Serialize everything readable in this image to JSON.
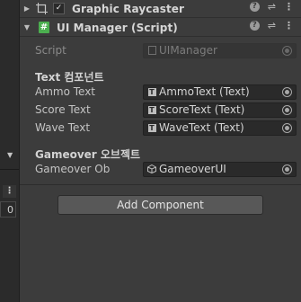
{
  "components": [
    {
      "title": "Graphic Raycaster",
      "enabled": true
    },
    {
      "title": "UI Manager (Script)",
      "script_icon": "#"
    }
  ],
  "script_row": {
    "label": "Script",
    "value": "UIManager"
  },
  "sections": [
    {
      "header": "Text 컴포넌트",
      "fields": [
        {
          "label": "Ammo Text",
          "value": "AmmoText (Text)",
          "icon": "text-icon"
        },
        {
          "label": "Score Text",
          "value": "ScoreText (Text)",
          "icon": "text-icon"
        },
        {
          "label": "Wave Text",
          "value": "WaveText (Text)",
          "icon": "text-icon"
        }
      ]
    },
    {
      "header": "Gameover 오브젝트",
      "fields": [
        {
          "label": "Gameover Ob",
          "value": "GameoverUI",
          "icon": "gameobject-icon"
        }
      ]
    }
  ],
  "add_component_label": "Add Component",
  "left_strip": {
    "value": "0"
  }
}
